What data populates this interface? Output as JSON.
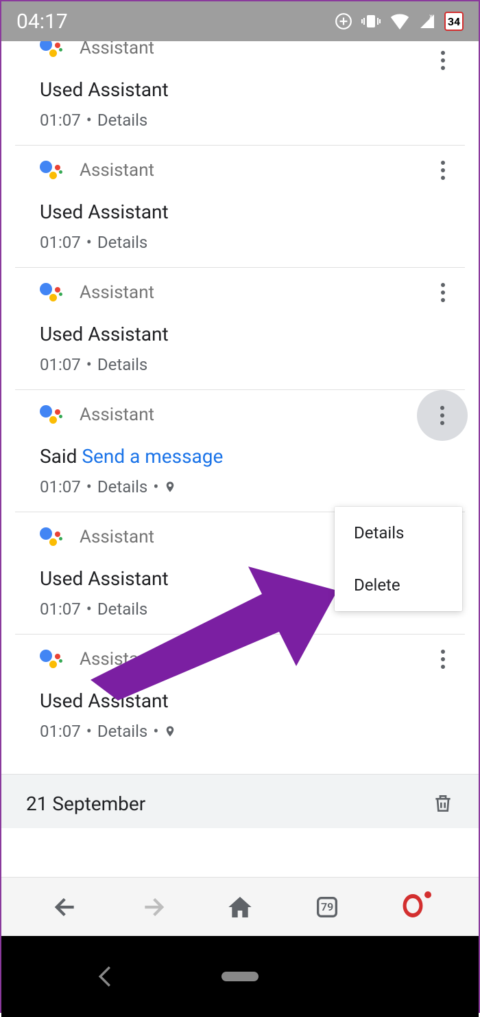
{
  "status_bar": {
    "time": "04:17",
    "battery_badge": "34"
  },
  "items": [
    {
      "source": "Assistant",
      "title_prefix": "",
      "title_main": "Used Assistant",
      "title_link": "",
      "time": "01:07",
      "details": "Details",
      "has_pin": false,
      "menu_open": false,
      "partial": true
    },
    {
      "source": "Assistant",
      "title_prefix": "",
      "title_main": "Used Assistant",
      "title_link": "",
      "time": "01:07",
      "details": "Details",
      "has_pin": false,
      "menu_open": false
    },
    {
      "source": "Assistant",
      "title_prefix": "",
      "title_main": "Used Assistant",
      "title_link": "",
      "time": "01:07",
      "details": "Details",
      "has_pin": false,
      "menu_open": false
    },
    {
      "source": "Assistant",
      "title_prefix": "Said ",
      "title_main": "",
      "title_link": "Send a message",
      "time": "01:07",
      "details": "Details",
      "has_pin": true,
      "menu_open": true
    },
    {
      "source": "Assistant",
      "title_prefix": "",
      "title_main": "Used Assistant",
      "title_link": "",
      "time": "01:07",
      "details": "Details",
      "has_pin": false,
      "menu_open": false
    },
    {
      "source": "Assistant",
      "title_prefix": "",
      "title_main": "Used Assistant",
      "title_link": "",
      "time": "01:07",
      "details": "Details",
      "has_pin": true,
      "menu_open": false
    }
  ],
  "popup": {
    "details": "Details",
    "delete": "Delete"
  },
  "date_header": {
    "label": "21 September"
  },
  "bottom_nav": {
    "tabs_count": "79"
  }
}
